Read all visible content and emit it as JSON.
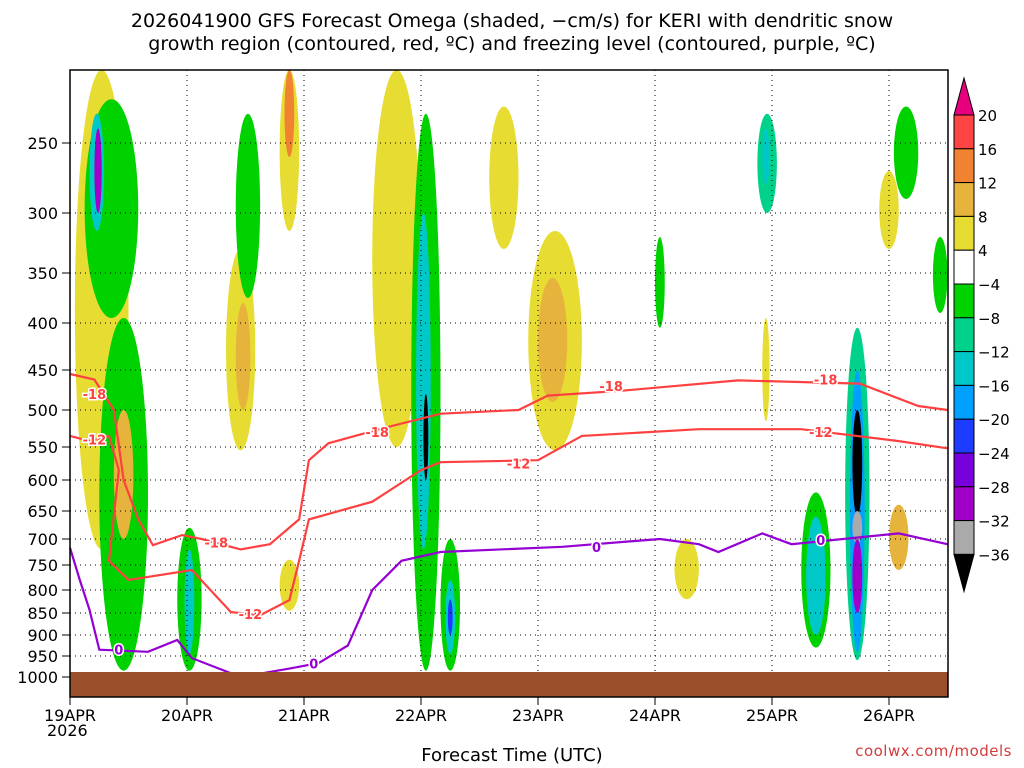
{
  "title": {
    "line1": "2026041900 GFS Forecast Omega (shaded, −cm/s) for KERI with dendritic snow",
    "line2": "growth region (contoured, red, ºC) and freezing level (contoured, purple, ºC)"
  },
  "credit": "coolwx.com/models",
  "chart_data": {
    "type": "heatmap",
    "title": "2026041900 GFS Forecast Omega (shaded, −cm/s) for KERI with dendritic snow growth region (contoured, red, ºC) and freezing level (contoured, purple, ºC)",
    "xlabel": "Forecast Time (UTC)",
    "ylabel": "",
    "x_units": "hours since 19APR2026 00Z",
    "xlim": [
      0,
      180
    ],
    "ylim": [
      1020,
      200
    ],
    "y_units": "hPa",
    "x_ticks": [
      {
        "h": 0,
        "label": "19APR"
      },
      {
        "h": 24,
        "label": "20APR"
      },
      {
        "h": 48,
        "label": "21APR"
      },
      {
        "h": 72,
        "label": "22APR"
      },
      {
        "h": 96,
        "label": "23APR"
      },
      {
        "h": 120,
        "label": "24APR"
      },
      {
        "h": 144,
        "label": "25APR"
      },
      {
        "h": 168,
        "label": "26APR"
      }
    ],
    "x_year_label": "2026",
    "y_ticks": [
      250,
      300,
      350,
      400,
      450,
      500,
      550,
      600,
      650,
      700,
      750,
      800,
      850,
      900,
      950,
      1000
    ],
    "grid": true,
    "colorbar": {
      "labels": [
        "20",
        "16",
        "12",
        "8",
        "4",
        "-4",
        "-8",
        "-12",
        "-16",
        "-20",
        "-24",
        "-28",
        "-32",
        "-36"
      ],
      "bins": [
        {
          "min": 20,
          "max": null,
          "color": "#e6007e"
        },
        {
          "min": 16,
          "max": 20,
          "color": "#ff4444"
        },
        {
          "min": 12,
          "max": 16,
          "color": "#f08232"
        },
        {
          "min": 8,
          "max": 12,
          "color": "#e6b43c"
        },
        {
          "min": 4,
          "max": 8,
          "color": "#e6dc32"
        },
        {
          "min": -4,
          "max": 4,
          "color": "#ffffff"
        },
        {
          "min": -8,
          "max": -4,
          "color": "#00d200"
        },
        {
          "min": -12,
          "max": -8,
          "color": "#00d28c"
        },
        {
          "min": -16,
          "max": -12,
          "color": "#00c8c8"
        },
        {
          "min": -20,
          "max": -16,
          "color": "#00a0ff"
        },
        {
          "min": -24,
          "max": -20,
          "color": "#1e3cff"
        },
        {
          "min": -28,
          "max": -24,
          "color": "#7800dc"
        },
        {
          "min": -32,
          "max": -28,
          "color": "#a000c8"
        },
        {
          "min": -36,
          "max": -32,
          "color": "#aaaaaa"
        },
        {
          "min": null,
          "max": -36,
          "color": "#000000"
        }
      ]
    },
    "omega_regions": [
      [
        1,
        12,
        200,
        720,
        6
      ],
      [
        3,
        14,
        220,
        395,
        -6
      ],
      [
        4,
        7,
        230,
        315,
        -14
      ],
      [
        5,
        6.5,
        240,
        300,
        -30
      ],
      [
        6,
        16,
        395,
        985,
        -6
      ],
      [
        9,
        13,
        500,
        700,
        10
      ],
      [
        22,
        27,
        680,
        985,
        -6
      ],
      [
        23.5,
        25.5,
        720,
        945,
        -14
      ],
      [
        32,
        38,
        330,
        555,
        6
      ],
      [
        34,
        37,
        380,
        500,
        10
      ],
      [
        34,
        39,
        230,
        375,
        -6
      ],
      [
        43,
        47,
        200,
        315,
        6
      ],
      [
        44,
        46,
        200,
        260,
        14
      ],
      [
        43,
        47,
        740,
        845,
        6
      ],
      [
        62,
        72,
        200,
        550,
        5
      ],
      [
        70,
        76,
        230,
        985,
        -6
      ],
      [
        71,
        74,
        300,
        720,
        -14
      ],
      [
        72.5,
        73.5,
        480,
        600,
        -38
      ],
      [
        76,
        80,
        700,
        985,
        -8
      ],
      [
        77,
        79,
        780,
        945,
        -14
      ],
      [
        77.5,
        78.5,
        820,
        900,
        -24
      ],
      [
        86,
        92,
        225,
        330,
        6
      ],
      [
        94,
        105,
        315,
        555,
        6
      ],
      [
        96,
        102,
        355,
        490,
        10
      ],
      [
        120,
        122,
        320,
        405,
        -6
      ],
      [
        124,
        129,
        700,
        820,
        6
      ],
      [
        141,
        145,
        230,
        300,
        -10
      ],
      [
        142,
        143.5,
        240,
        280,
        -14
      ],
      [
        142,
        143.5,
        395,
        515,
        6
      ],
      [
        150,
        156,
        620,
        930,
        -6
      ],
      [
        151,
        155,
        660,
        900,
        -14
      ],
      [
        159,
        164,
        405,
        960,
        -12
      ],
      [
        160,
        163,
        450,
        940,
        -20
      ],
      [
        160.5,
        162.5,
        500,
        660,
        -38
      ],
      [
        160.5,
        162.5,
        650,
        710,
        -34
      ],
      [
        160.5,
        162.5,
        700,
        850,
        -30
      ],
      [
        166,
        170,
        270,
        330,
        6
      ],
      [
        168,
        172,
        640,
        760,
        8
      ],
      [
        169,
        174,
        225,
        290,
        -6
      ],
      [
        177,
        180,
        320,
        390,
        -6
      ]
    ],
    "contours": [
      {
        "name": "dgz-minus18",
        "value": -18,
        "label": "-18",
        "color": "#ff4040",
        "points": [
          [
            0,
            455
          ],
          [
            5,
            462
          ],
          [
            9,
            500
          ],
          [
            11,
            600
          ],
          [
            14,
            665
          ],
          [
            17,
            712
          ],
          [
            23,
            693
          ],
          [
            27,
            700
          ],
          [
            35,
            720
          ],
          [
            41,
            710
          ],
          [
            47,
            665
          ],
          [
            49,
            570
          ],
          [
            53,
            545
          ],
          [
            64,
            525
          ],
          [
            76,
            505
          ],
          [
            92,
            500
          ],
          [
            98,
            482
          ],
          [
            113,
            476
          ],
          [
            137,
            463
          ],
          [
            162,
            467
          ],
          [
            174,
            495
          ],
          [
            180,
            500
          ]
        ],
        "label_at": [
          [
            5,
            480
          ],
          [
            30,
            707
          ],
          [
            63,
            530
          ],
          [
            111,
            470
          ],
          [
            155,
            462
          ]
        ]
      },
      {
        "name": "dgz-minus12",
        "value": -12,
        "label": "-12",
        "color": "#ff4040",
        "points": [
          [
            0,
            535
          ],
          [
            4,
            542
          ],
          [
            8,
            535
          ],
          [
            10,
            585
          ],
          [
            8,
            742
          ],
          [
            12,
            780
          ],
          [
            25,
            760
          ],
          [
            33,
            848
          ],
          [
            39,
            855
          ],
          [
            45,
            822
          ],
          [
            47,
            742
          ],
          [
            49,
            665
          ],
          [
            62,
            635
          ],
          [
            72,
            585
          ],
          [
            76,
            573
          ],
          [
            96,
            570
          ],
          [
            105,
            535
          ],
          [
            129,
            526
          ],
          [
            150,
            526
          ],
          [
            170,
            542
          ],
          [
            180,
            552
          ]
        ],
        "label_at": [
          [
            5,
            540
          ],
          [
            37,
            852
          ],
          [
            92,
            575
          ],
          [
            154,
            530
          ]
        ]
      },
      {
        "name": "freezing-level-0",
        "value": 0,
        "label": "0",
        "color": "#9400d3",
        "points": [
          [
            0,
            717
          ],
          [
            2,
            780
          ],
          [
            4,
            843
          ],
          [
            6,
            935
          ],
          [
            16,
            940
          ],
          [
            22,
            912
          ],
          [
            25,
            955
          ],
          [
            35,
            1000
          ],
          [
            45,
            980
          ],
          [
            51,
            967
          ],
          [
            57,
            925
          ],
          [
            62,
            800
          ],
          [
            68,
            742
          ],
          [
            76,
            725
          ],
          [
            101,
            715
          ],
          [
            121,
            700
          ],
          [
            129,
            710
          ],
          [
            133,
            725
          ],
          [
            142,
            690
          ],
          [
            148,
            710
          ],
          [
            170,
            690
          ],
          [
            180,
            710
          ]
        ],
        "label_at": [
          [
            10,
            935
          ],
          [
            50,
            968
          ],
          [
            108,
            715
          ],
          [
            154,
            702
          ]
        ]
      }
    ],
    "surface": {
      "label": "ground",
      "color": "#9b4f2a"
    }
  }
}
